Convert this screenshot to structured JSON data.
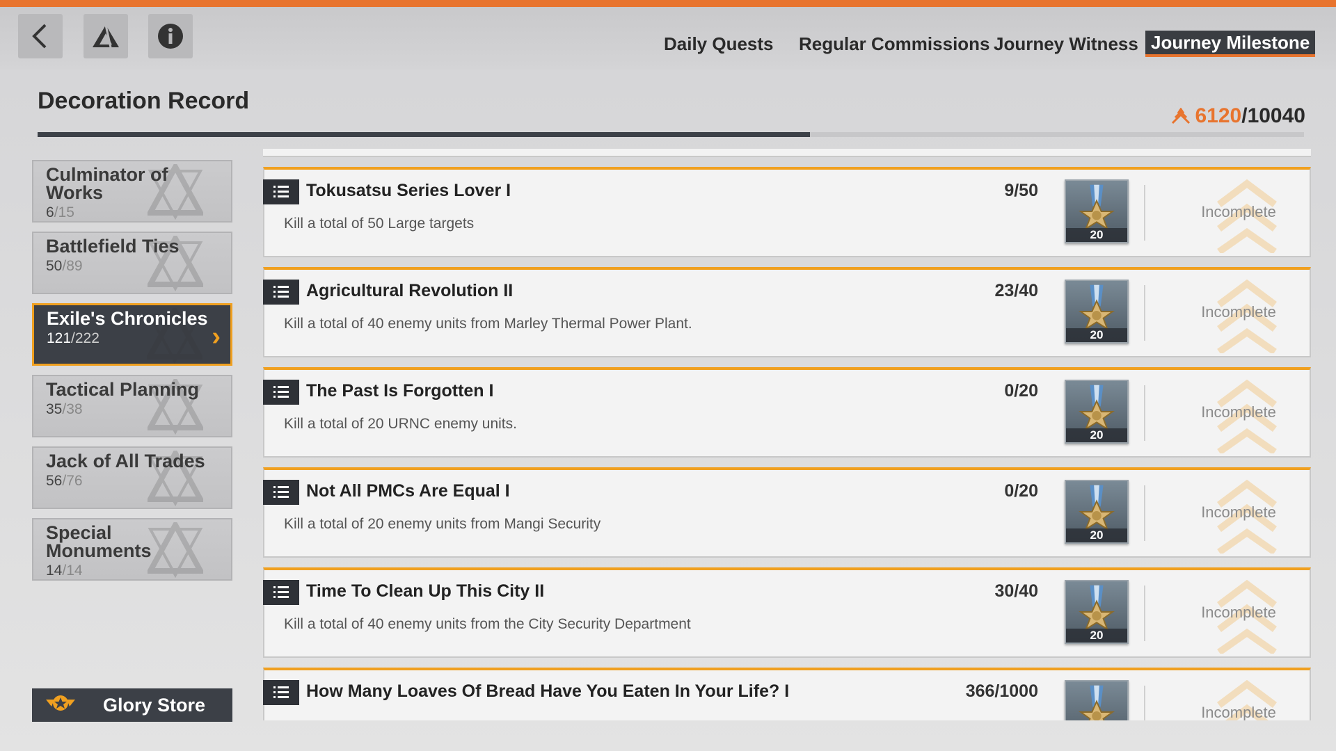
{
  "top_nav": {
    "tabs": [
      {
        "label": "Daily Quests"
      },
      {
        "label": "Regular Commissions"
      },
      {
        "label": "Journey Witness"
      },
      {
        "label": "Journey Milestone"
      }
    ]
  },
  "header": {
    "title": "Decoration Record",
    "current": "6120",
    "separator": "/",
    "total": "10040",
    "progress_fraction": 0.61
  },
  "sidebar": {
    "items": [
      {
        "name": "Culminator of Works",
        "done": "6",
        "total": "/15",
        "active": false
      },
      {
        "name": "Battlefield Ties",
        "done": "50",
        "total": "/89",
        "active": false
      },
      {
        "name": "Exile's Chronicles",
        "done": "121",
        "total": "/222",
        "active": true
      },
      {
        "name": "Tactical Planning",
        "done": "35",
        "total": "/38",
        "active": false
      },
      {
        "name": "Jack of All Trades",
        "done": "56",
        "total": "/76",
        "active": false
      },
      {
        "name": "Special Monuments",
        "done": "14",
        "total": "/14",
        "active": false
      }
    ],
    "store_label": "Glory Store"
  },
  "tasks": [
    {
      "title": "Tokusatsu Series Lover I",
      "desc": "Kill a total of 50 Large targets",
      "progress": "9/50",
      "reward": "20",
      "status": "Incomplete"
    },
    {
      "title": "Agricultural Revolution II",
      "desc": "Kill a total of 40 enemy units from Marley Thermal Power Plant.",
      "progress": "23/40",
      "reward": "20",
      "status": "Incomplete"
    },
    {
      "title": "The Past Is Forgotten I",
      "desc": "Kill a total of 20 URNC enemy units.",
      "progress": "0/20",
      "reward": "20",
      "status": "Incomplete"
    },
    {
      "title": "Not All PMCs Are Equal I",
      "desc": "Kill a total of 20 enemy units from Mangi Security",
      "progress": "0/20",
      "reward": "20",
      "status": "Incomplete"
    },
    {
      "title": "Time To Clean Up This City II",
      "desc": "Kill a total of 40 enemy units from the City Security Department",
      "progress": "30/40",
      "reward": "20",
      "status": "Incomplete"
    },
    {
      "title": "How Many Loaves Of Bread Have You Eaten In Your Life? I",
      "desc": "",
      "progress": "366/1000",
      "reward": "",
      "status": "Incomplete"
    }
  ],
  "colors": {
    "accent": "#e8742e",
    "highlight": "#f0a020",
    "dark": "#3c4047"
  },
  "icons": [
    "back-icon",
    "triangle-logo-icon",
    "info-icon",
    "list-icon",
    "medal-icon",
    "glory-star-icon",
    "points-icon"
  ]
}
